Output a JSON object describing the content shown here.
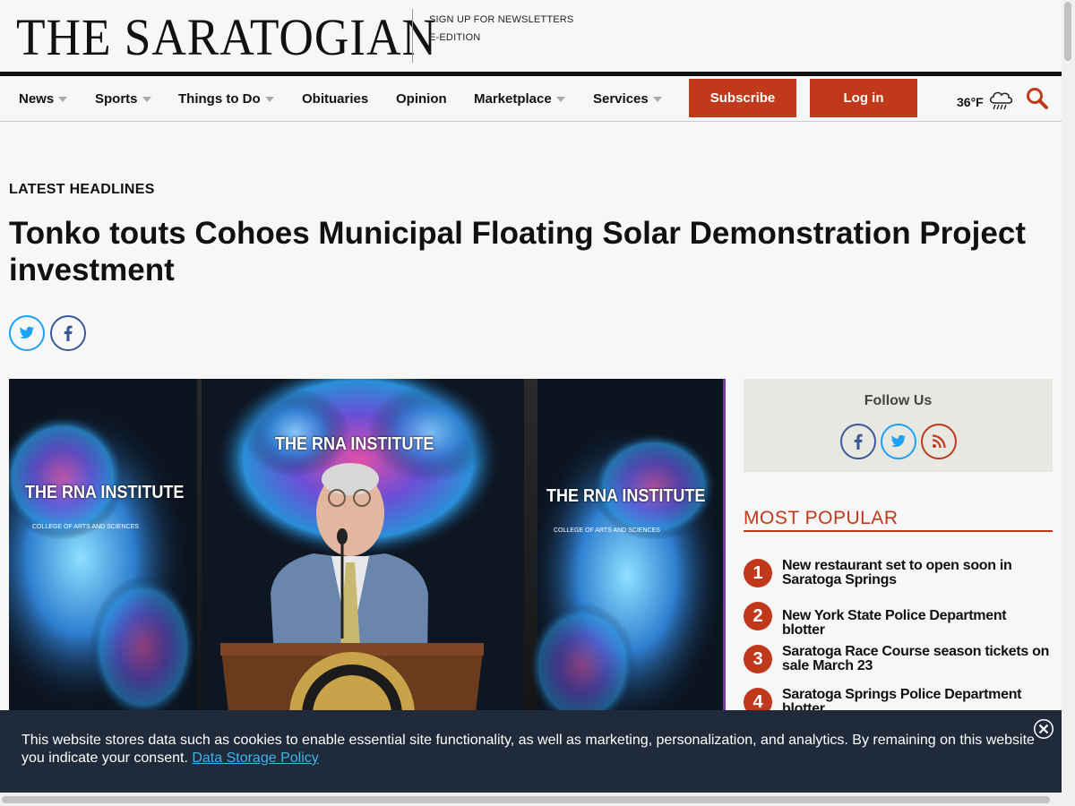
{
  "masthead": {
    "logo": "THE SARATOGIAN",
    "links": [
      "SIGN UP FOR NEWSLETTERS",
      "E-EDITION"
    ]
  },
  "nav": {
    "items": [
      {
        "label": "News",
        "dropdown": true
      },
      {
        "label": "Sports",
        "dropdown": true
      },
      {
        "label": "Things to Do",
        "dropdown": true
      },
      {
        "label": "Obituaries",
        "dropdown": false
      },
      {
        "label": "Opinion",
        "dropdown": false
      },
      {
        "label": "Marketplace",
        "dropdown": true
      },
      {
        "label": "Services",
        "dropdown": true
      }
    ],
    "subscribe_label": "Subscribe",
    "login_label": "Log in",
    "temperature": "36°F",
    "weather_icon": "rain-cloud-icon",
    "search_icon": "search-icon"
  },
  "article": {
    "kicker": "LATEST HEADLINES",
    "headline": "Tonko touts Cohoes Municipal Floating Solar Demonstration Project investment",
    "share": [
      "twitter-icon",
      "facebook-icon"
    ],
    "photo": {
      "banners": [
        "THE RNA INSTITUTE",
        "THE RNA INSTITUTE",
        "THE RNA INSTITUTE"
      ],
      "banner_subtitle": "COLLEGE OF ARTS AND SCIENCES"
    }
  },
  "sidebar": {
    "follow_title": "Follow Us",
    "follow_icons": [
      "facebook-icon",
      "twitter-icon",
      "rss-icon"
    ],
    "most_popular_title": "MOST POPULAR",
    "most_popular": [
      {
        "rank": "1",
        "title": "New restaurant set to open soon in Saratoga Springs"
      },
      {
        "rank": "2",
        "title": "New York State Police Department blotter"
      },
      {
        "rank": "3",
        "title": "Saratoga Race Course season tickets on sale March 23"
      },
      {
        "rank": "4",
        "title": "Saratoga Springs Police Department blotter"
      }
    ]
  },
  "cookie_banner": {
    "text": "This website stores data such as cookies to enable essential site functionality, as well as marketing, personalization, and analytics. By remaining on this website you indicate your consent.",
    "link_label": "Data Storage Policy"
  },
  "colors": {
    "accent": "#c0391b",
    "twitter": "#1da1f2",
    "facebook": "#3b5998",
    "banner_bg": "#1f2b3a"
  }
}
